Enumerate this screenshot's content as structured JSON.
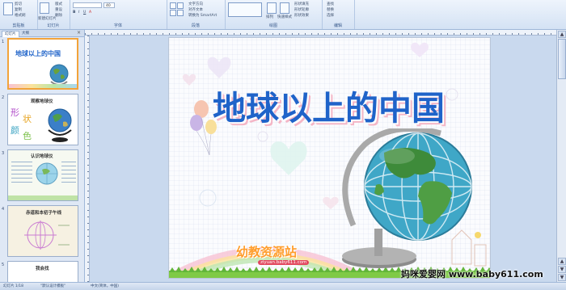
{
  "ribbon": {
    "groups": [
      {
        "label": "剪贴板"
      },
      {
        "label": "幻灯片"
      },
      {
        "label": "字体"
      },
      {
        "label": "段落"
      },
      {
        "label": "绘图"
      },
      {
        "label": "编辑"
      }
    ],
    "font_size_value": "40",
    "clipboard_items": [
      "剪切",
      "复制",
      "格式刷"
    ],
    "slides_items": [
      "版式",
      "重设",
      "删除"
    ],
    "new_slide_label": "新建幻灯片",
    "paragraph_items": [
      "文字方向",
      "对齐文本",
      "转换为 SmartArt"
    ],
    "drawing_items": [
      "形状填充",
      "形状轮廓",
      "形状效果"
    ],
    "arrange_label": "排列",
    "quick_styles_label": "快速样式",
    "editing_items": [
      "查找",
      "替换",
      "选择"
    ]
  },
  "left_panel": {
    "tabs": [
      "幻灯片",
      "大纲"
    ],
    "close_glyph": "×",
    "slides": [
      {
        "num": "1",
        "title": "地球以上的中国"
      },
      {
        "num": "2",
        "title": "观察地球仪",
        "side_text": [
          "形",
          "状",
          "颜",
          "色"
        ]
      },
      {
        "num": "3",
        "title": "认识地球仪"
      },
      {
        "num": "4",
        "title": "赤道和本初子午线"
      },
      {
        "num": "5",
        "title": "我会找"
      }
    ]
  },
  "slide": {
    "title": "地球以上的中国",
    "logo": "幼教资源站",
    "logo_url": "ziyuan.baby611.com"
  },
  "status": {
    "slide_info": "幻灯片 1/18",
    "theme": "\"默认设计模板\"",
    "language": "中文(简体，中国)"
  },
  "watermark": "妈咪爱婴网 www.baby611.com",
  "colors": {
    "title": "#1f63c9",
    "title_shadow": "#f4b6c6",
    "ribbon": "#d4e2f4",
    "selected_border": "#f2a33a"
  }
}
